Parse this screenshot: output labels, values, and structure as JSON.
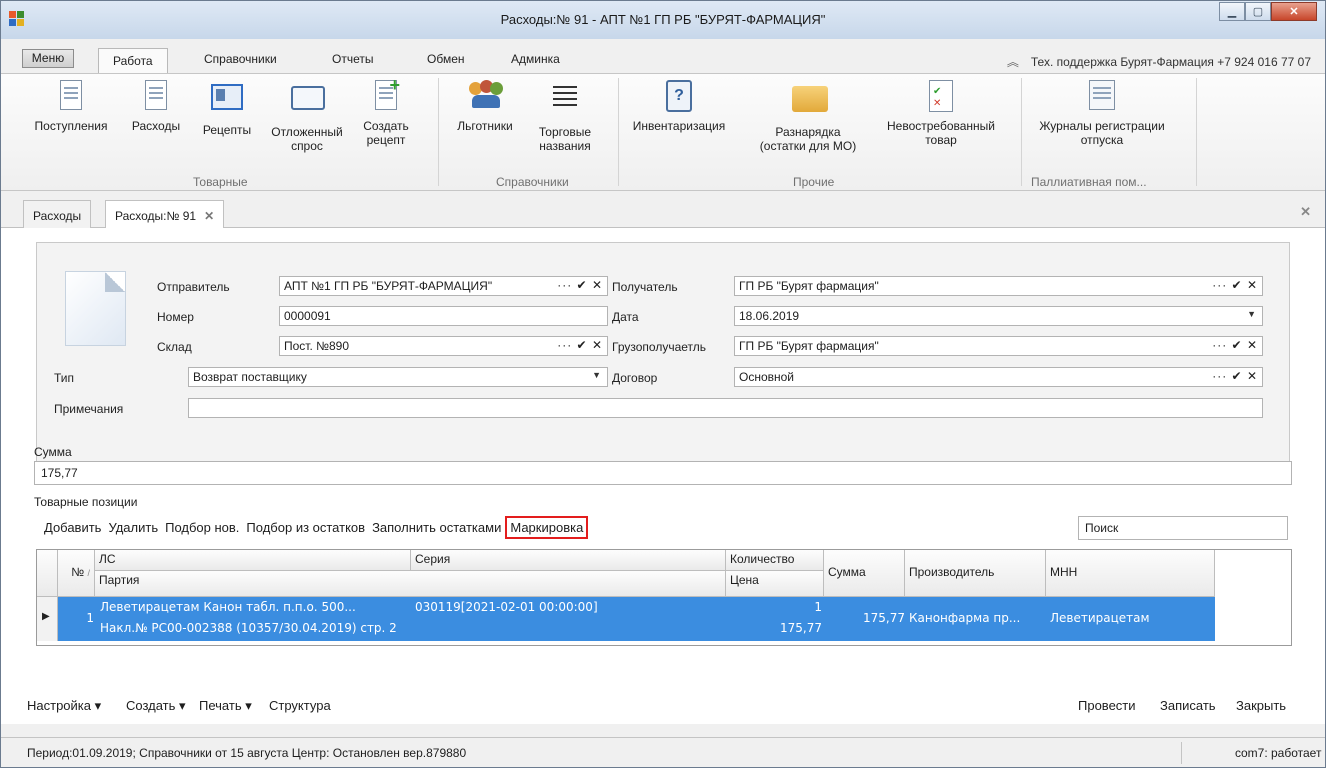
{
  "window": {
    "title": "Расходы:№ 91 - АПТ №1 ГП РБ \"БУРЯТ-ФАРМАЦИЯ\""
  },
  "ribbon_tabs": [
    "Меню",
    "Работа",
    "Справочники",
    "Отчеты",
    "Обмен",
    "Админка"
  ],
  "support_text": "Тех. поддержка Бурят-Фармация +7 924 016 77 07",
  "ribbon": {
    "buttons": [
      {
        "label1": "Поступления",
        "label2": ""
      },
      {
        "label1": "Расходы",
        "label2": ""
      },
      {
        "label1": "Рецепты",
        "label2": ""
      },
      {
        "label1": "Отложенный",
        "label2": "спрос"
      },
      {
        "label1": "Создать",
        "label2": "рецепт"
      },
      {
        "label1": "Льготники",
        "label2": ""
      },
      {
        "label1": "Торговые",
        "label2": "названия"
      },
      {
        "label1": "Инвентаризация",
        "label2": ""
      },
      {
        "label1": "Разнарядка",
        "label2": "(остатки для МО)"
      },
      {
        "label1": "Невостребованный",
        "label2": "товар"
      },
      {
        "label1": "Журналы регистрации",
        "label2": "отпуска"
      }
    ],
    "groups": [
      "Товарные",
      "Справочники",
      "Прочие",
      "Паллиативная пом..."
    ]
  },
  "doc_tabs": [
    "Расходы",
    "Расходы:№ 91"
  ],
  "form": {
    "sender_label": "Отправитель",
    "sender_value": "АПТ №1 ГП РБ \"БУРЯТ-ФАРМАЦИЯ\"",
    "number_label": "Номер",
    "number_value": "0000091",
    "store_label": "Склад",
    "store_value": "Пост. №890",
    "type_label": "Тип",
    "type_value": "Возврат поставщику",
    "notes_label": "Примечания",
    "notes_value": "",
    "recipient_label": "Получатель",
    "recipient_value": "ГП РБ \"Бурят фармация\"",
    "date_label": "Дата",
    "date_value": "18.06.2019",
    "consignee_label": "Грузополучаетль",
    "consignee_value": "ГП РБ \"Бурят фармация\"",
    "contract_label": "Договор",
    "contract_value": "Основной",
    "field_buttons": "··· ✔ ✕"
  },
  "sum": {
    "label": "Сумма",
    "value": "175,77"
  },
  "items_label": "Товарные позиции",
  "items_toolbar": [
    "Добавить",
    "Удалить",
    "Подбор нов.",
    "Подбор из остатков",
    "Заполнить остатками",
    "Маркировка"
  ],
  "search_placeholder": "Поиск",
  "grid": {
    "headers": {
      "num": "№",
      "ls": "ЛС",
      "party": "Партия",
      "series": "Серия",
      "qty": "Количество",
      "price": "Цена",
      "sum": "Сумма",
      "manufacturer": "Производитель",
      "mnn": "МНН"
    },
    "row": {
      "num": "1",
      "ls": "Леветирацетам Канон табл. п.п.о. 500...",
      "series": "030119[2021-02-01 00:00:00]",
      "party": "Накл.№ РС00-002388 (10357/30.04.2019) стр. 2",
      "qty": "1",
      "price": "175,77",
      "sum": "175,77",
      "manufacturer": "Канонфарма пр...",
      "mnn": "Леветирацетам"
    }
  },
  "bottom_left": [
    "Настройка ▾",
    "Создать ▾",
    "Печать ▾",
    "Структура"
  ],
  "bottom_right": [
    "Провести",
    "Записать",
    "Закрыть"
  ],
  "status": {
    "left": "Период:01.09.2019; Справочники от 15 августа   Центр: Остановлен вер.879880",
    "right": "com7: работает"
  }
}
